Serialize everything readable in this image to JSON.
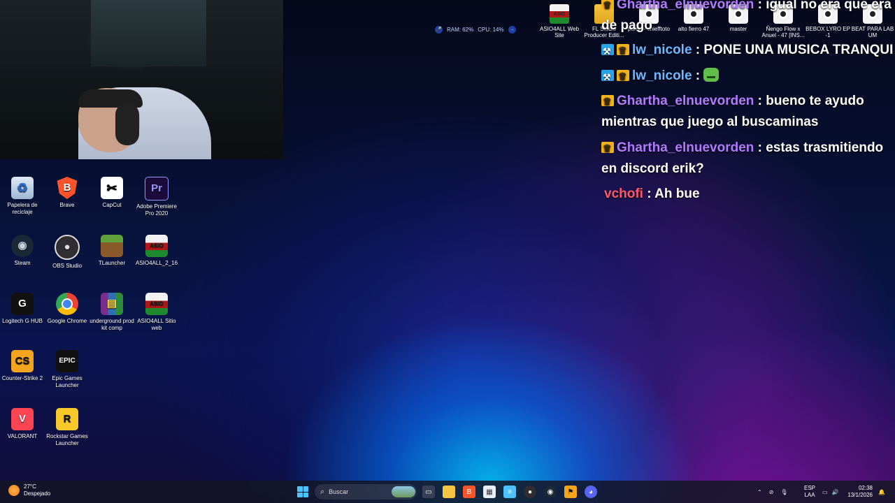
{
  "system_monitor": {
    "ram": "RAM: 62%",
    "cpu": "CPU: 14%"
  },
  "top_icons": [
    {
      "label": "ASIO4ALL Web Site",
      "icon": "asio4all-icon"
    },
    {
      "label": "FL Studio Producer Editi...",
      "icon": "folder-icon"
    },
    {
      "label": "paran - chiefftoto",
      "icon": "media-file-icon"
    },
    {
      "label": "alto fierro 47",
      "icon": "media-file-icon"
    },
    {
      "label": "master",
      "icon": "media-file-icon"
    },
    {
      "label": "Ñengo Flow x Anuel - 47 [INS...",
      "icon": "media-file-icon"
    },
    {
      "label": "BEBOX LYRO EP -1",
      "icon": "media-file-icon"
    },
    {
      "label": "BEAT PARA LAB UM",
      "icon": "media-file-icon"
    }
  ],
  "chat": {
    "messages": [
      {
        "user": "Ghartha_elnuevorden",
        "text": " : igual no era que era de pago"
      },
      {
        "user": "lw_nicole",
        "text": " : PONE UNA MUSICA TRANQUI"
      },
      {
        "user": "lw_nicole",
        "text": " : "
      },
      {
        "user": "Ghartha_elnuevorden",
        "text": " : bueno te ayudo mientras que juego al buscaminas"
      },
      {
        "user": "Ghartha_elnuevorden",
        "text": " : estas trasmitiendo en discord erik?"
      },
      {
        "user": "vchofi",
        "text": " : Ah bue"
      }
    ]
  },
  "desktop_icons": [
    {
      "label": "Papelera de reciclaje",
      "glyph": "♻"
    },
    {
      "label": "Brave",
      "glyph": "B"
    },
    {
      "label": "CapCut",
      "glyph": "✂"
    },
    {
      "label": "Adobe Premiere Pro 2020",
      "glyph": "Pr"
    },
    {
      "label": "Steam",
      "glyph": "◉"
    },
    {
      "label": "OBS Studio",
      "glyph": "●"
    },
    {
      "label": "TLauncher",
      "glyph": ""
    },
    {
      "label": "ASIO4ALL_2_16",
      "glyph": "ASIO"
    },
    {
      "label": "Logitech G HUB",
      "glyph": "G"
    },
    {
      "label": "Google Chrome",
      "glyph": ""
    },
    {
      "label": "underground prod kit comp",
      "glyph": "▤"
    },
    {
      "label": "ASIO4ALL Sitio web",
      "glyph": "ASIO"
    },
    {
      "label": "Counter-Strike 2",
      "glyph": "CS"
    },
    {
      "label": "Epic Games Launcher",
      "glyph": "EPIC"
    },
    {
      "label": "VALORANT",
      "glyph": "V"
    },
    {
      "label": "Rockstar Games Launcher",
      "glyph": "R"
    }
  ],
  "taskbar": {
    "weather_temp": "27°C",
    "weather_desc": "Despejado",
    "search_placeholder": "Buscar",
    "lang_top": "ESP",
    "lang_bottom": "LAA",
    "time": "02:38",
    "date": "13/1/2026"
  }
}
